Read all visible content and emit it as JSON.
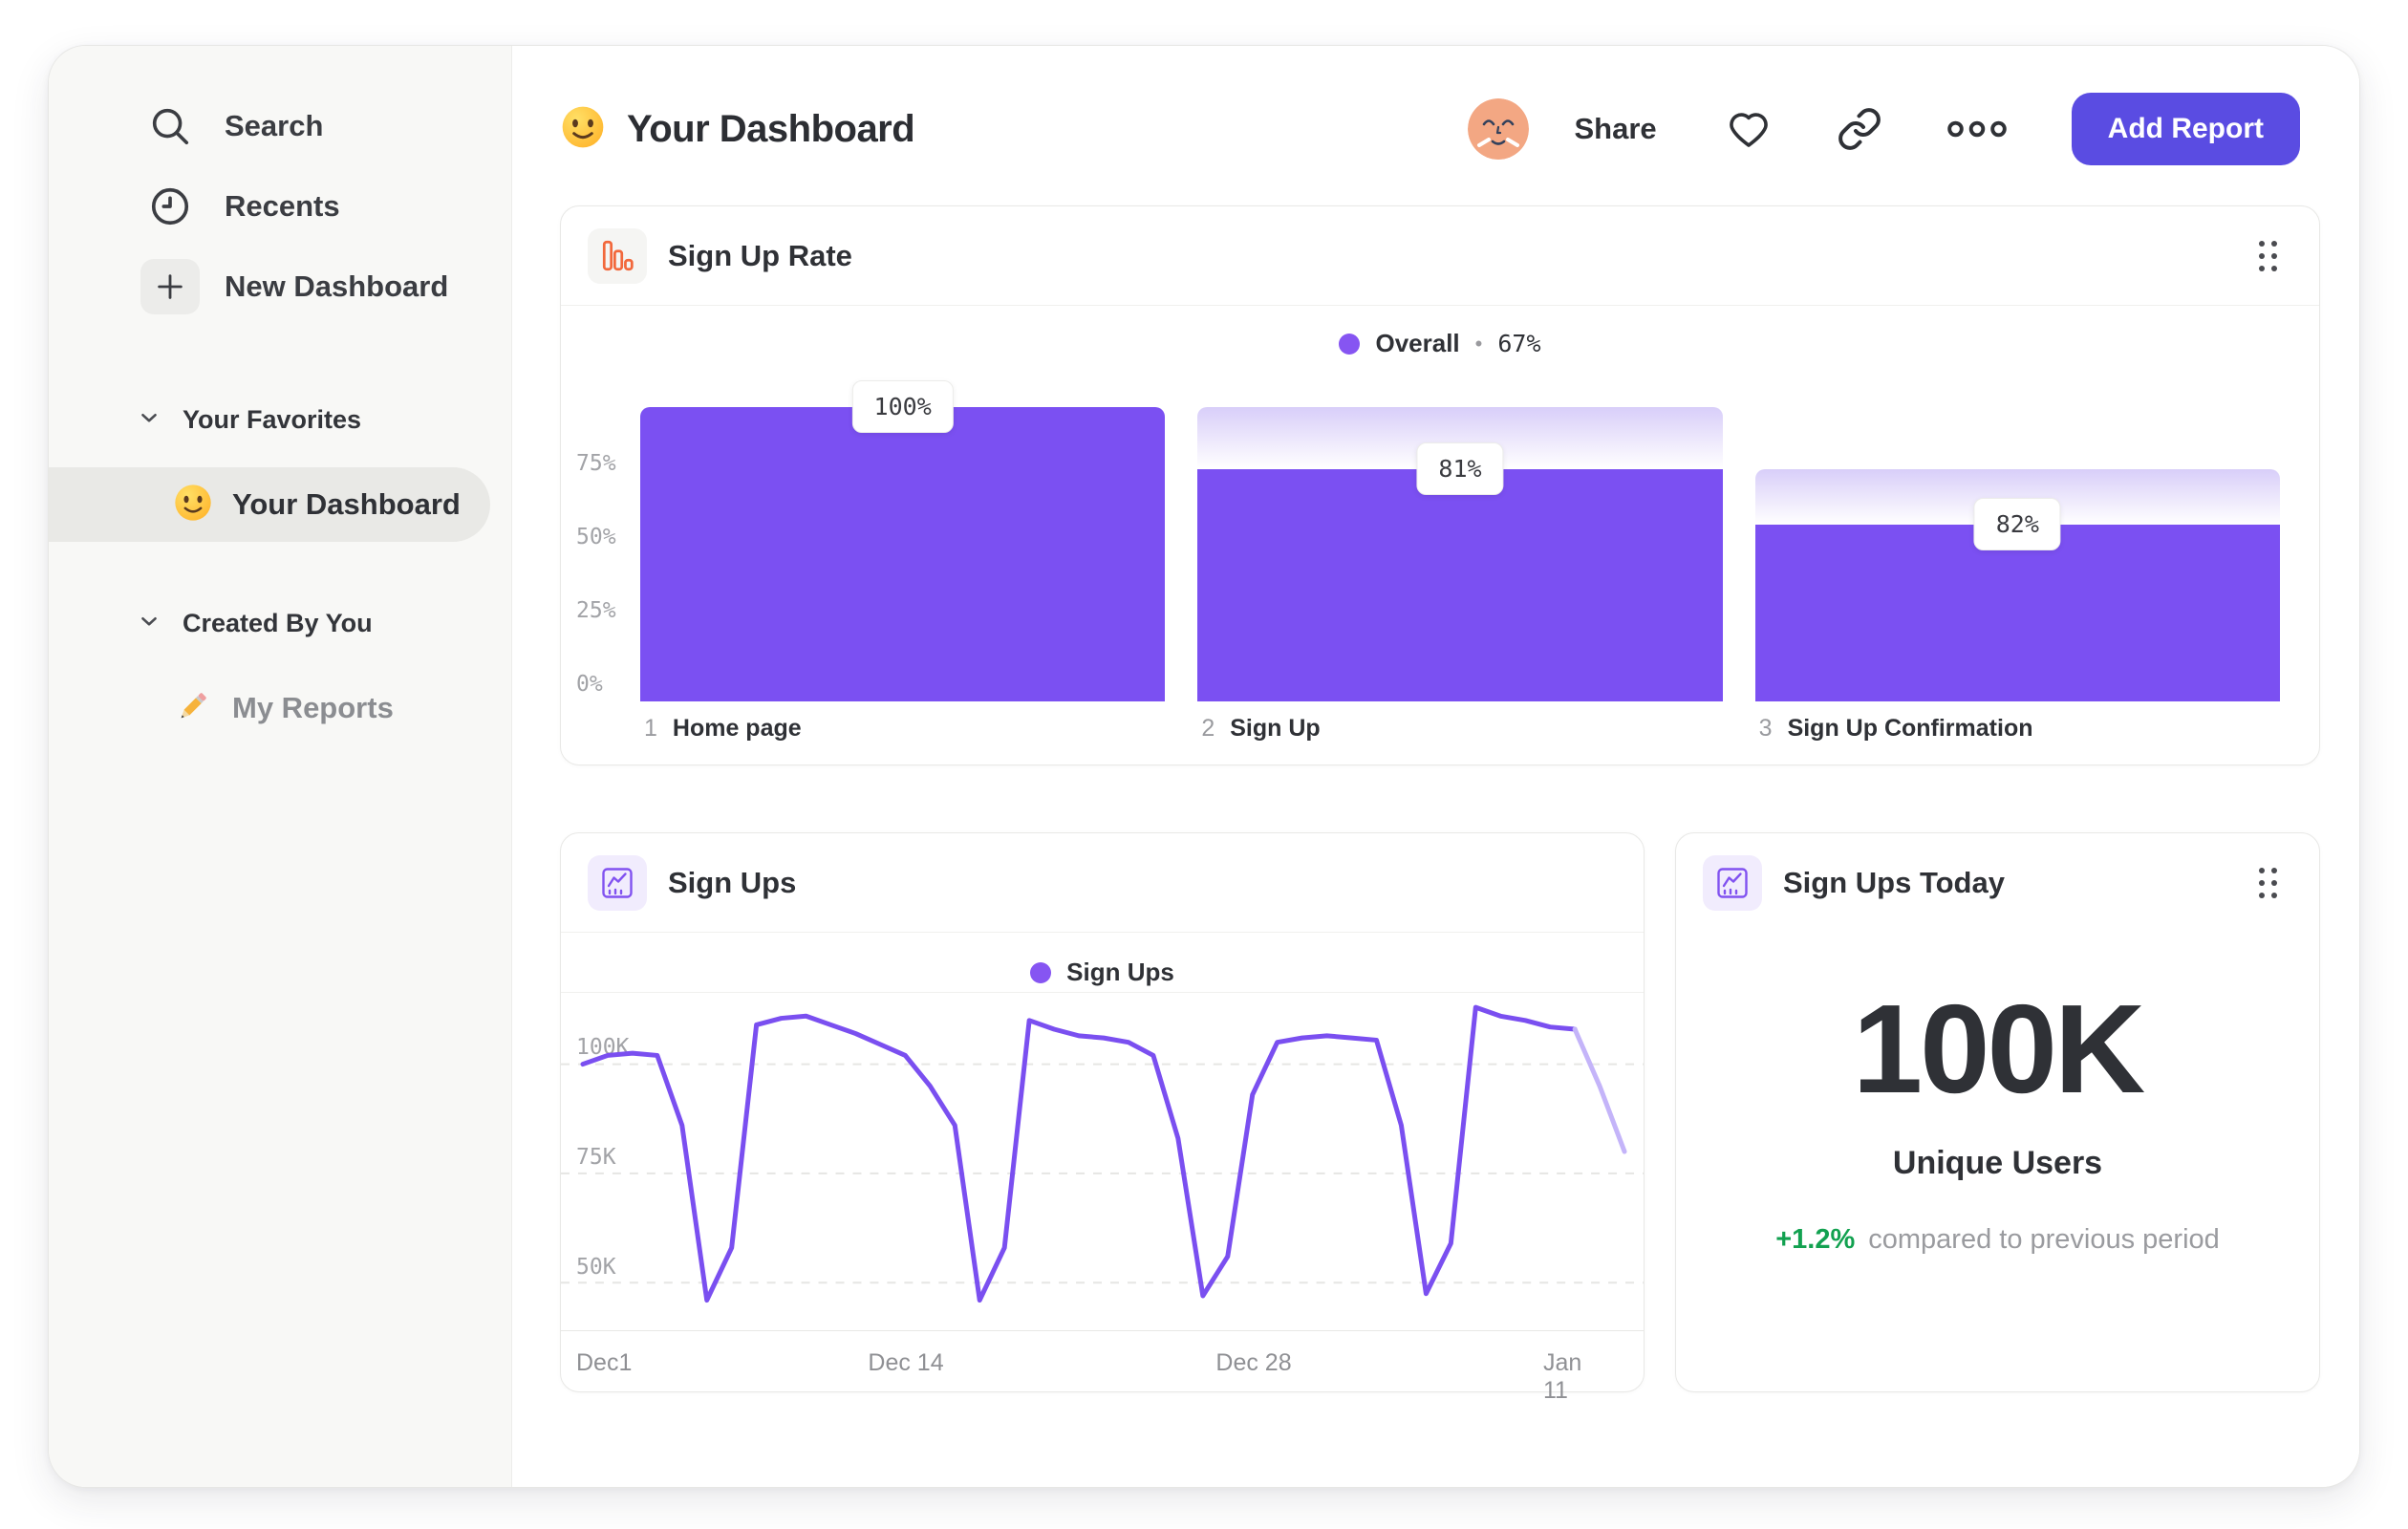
{
  "sidebar": {
    "nav": [
      {
        "label": "Search",
        "icon": "search-icon"
      },
      {
        "label": "Recents",
        "icon": "clock-icon"
      },
      {
        "label": "New Dashboard",
        "icon": "plus-icon"
      }
    ],
    "sections": [
      {
        "title": "Your Favorites",
        "items": [
          {
            "label": "Your Dashboard",
            "emoji": "smiley-emoji",
            "selected": true
          }
        ]
      },
      {
        "title": "Created By You",
        "items": [
          {
            "label": "My Reports",
            "emoji": "pencil-emoji",
            "selected": false
          }
        ]
      }
    ]
  },
  "header": {
    "title": "Your Dashboard",
    "title_emoji": "smiley-emoji",
    "share_label": "Share",
    "add_report_label": "Add Report"
  },
  "cards": {
    "funnel": {
      "title": "Sign Up Rate",
      "legend": {
        "series": "Overall",
        "sep": "•",
        "value": "67%"
      }
    },
    "line": {
      "title": "Sign Ups",
      "legend": "Sign Ups"
    },
    "metric": {
      "title": "Sign Ups Today"
    }
  },
  "chart_data": [
    {
      "type": "bar",
      "subtype": "funnel",
      "title": "Sign Up Rate",
      "series_name": "Overall",
      "overall_conversion": "67%",
      "step_numbers": [
        "1",
        "2",
        "3"
      ],
      "categories": [
        "Home page",
        "Sign Up",
        "Sign Up Confirmation"
      ],
      "values_pct": [
        "100%",
        "81%",
        "82%"
      ],
      "step_conversion_pct": [
        100,
        81,
        82
      ],
      "bar_height_pct": [
        100,
        79,
        60
      ],
      "ghost_top_pct": [
        null,
        100,
        79
      ],
      "ylabels": [
        "75%",
        "50%",
        "25%",
        "0%"
      ],
      "ylim": [
        0,
        100
      ],
      "grid": false,
      "legend_position": "top-center",
      "bar_color": "#7b50f2"
    },
    {
      "type": "line",
      "title": "Sign Ups",
      "series": [
        {
          "name": "Sign Ups",
          "values": [
            100,
            102,
            102.5,
            102,
            86,
            46,
            58,
            109,
            110.5,
            111,
            109,
            107,
            104.5,
            102,
            95,
            86,
            46,
            58,
            110,
            108,
            106.5,
            106,
            105,
            102,
            83,
            47,
            56,
            93,
            105,
            106,
            106.5,
            106,
            105.5,
            86,
            47.5,
            59,
            113,
            111,
            110,
            108.5,
            108,
            95,
            80
          ]
        }
      ],
      "x_tick_labels": [
        "Dec1",
        "Dec 14",
        "Dec 28",
        "Jan 11"
      ],
      "x_tick_index": [
        0,
        13,
        27,
        40
      ],
      "ylabels": [
        "100K",
        "75K",
        "50K"
      ],
      "y_gridlines_k": [
        100,
        75,
        50
      ],
      "ylim_k": [
        39,
        116
      ],
      "grid": "dashed-horizontal",
      "legend_position": "top-center",
      "faded_from_index": 40,
      "line_color": "#7a4ff0",
      "faded_color": "#c4b4f9"
    },
    {
      "type": "metric",
      "title": "Sign Ups Today",
      "value": "100K",
      "label": "Unique Users",
      "delta_pct": "+1.2%",
      "delta_note": "compared to previous period",
      "delta_color": "#12a150"
    }
  ],
  "colors": {
    "accent_purple": "#7b50f2",
    "legend_dot": "#8655f2",
    "button_indigo": "#5a4ce2",
    "positive_green": "#12a150",
    "funnel_icon_orange": "#f2683c",
    "avatar_peach": "#f3a783",
    "sidebar_bg": "#f8f8f6",
    "selected_pill": "#e9e9e6",
    "faded_line": "#c4b4f9"
  }
}
